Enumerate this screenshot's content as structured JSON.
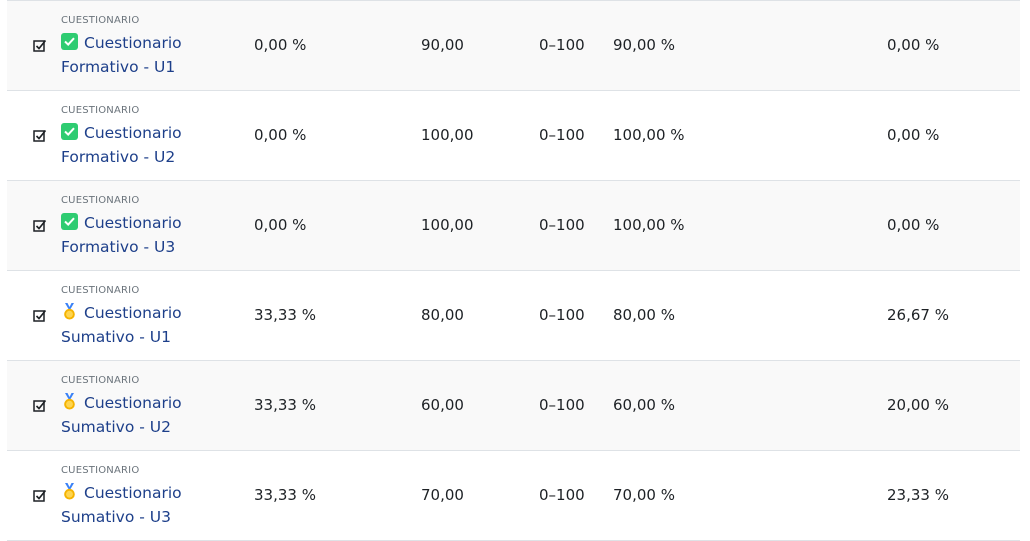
{
  "rows": [
    {
      "modname": "CUESTIONARIO",
      "icon": "green-check-emoji",
      "title": "Cuestionario Formativo - U1",
      "weight": "0,00 %",
      "grade": "90,00",
      "range": "0–100",
      "percentage": "90,00 %",
      "contribution": "0,00 %"
    },
    {
      "modname": "CUESTIONARIO",
      "icon": "green-check-emoji",
      "title": "Cuestionario Formativo - U2",
      "weight": "0,00 %",
      "grade": "100,00",
      "range": "0–100",
      "percentage": "100,00 %",
      "contribution": "0,00 %"
    },
    {
      "modname": "CUESTIONARIO",
      "icon": "green-check-emoji",
      "title": "Cuestionario Formativo - U3",
      "weight": "0,00 %",
      "grade": "100,00",
      "range": "0–100",
      "percentage": "100,00 %",
      "contribution": "0,00 %"
    },
    {
      "modname": "CUESTIONARIO",
      "icon": "medal-emoji",
      "title": "Cuestionario Sumativo - U1",
      "weight": "33,33 %",
      "grade": "80,00",
      "range": "0–100",
      "percentage": "80,00 %",
      "contribution": "26,67 %"
    },
    {
      "modname": "CUESTIONARIO",
      "icon": "medal-emoji",
      "title": "Cuestionario Sumativo - U2",
      "weight": "33,33 %",
      "grade": "60,00",
      "range": "0–100",
      "percentage": "60,00 %",
      "contribution": "20,00 %"
    },
    {
      "modname": "CUESTIONARIO",
      "icon": "medal-emoji",
      "title": "Cuestionario Sumativo - U3",
      "weight": "33,33 %",
      "grade": "70,00",
      "range": "0–100",
      "percentage": "70,00 %",
      "contribution": "23,33 %"
    }
  ],
  "colors": {
    "link": "#1d3f8a",
    "check_green": "#2ecc71",
    "medal_gold": "#f5b301",
    "ribbon_blue": "#3b82f6",
    "row_stripe": "#f9f9f9",
    "border": "#dee2e6"
  }
}
